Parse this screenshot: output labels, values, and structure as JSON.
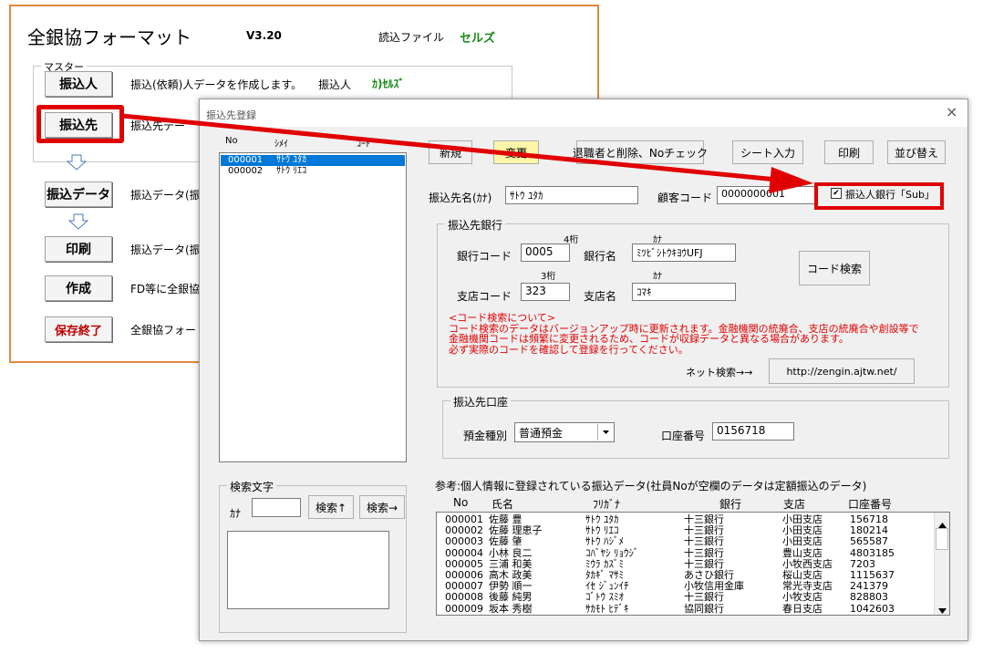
{
  "main": {
    "title": "全銀協フォーマット",
    "version": "V3.20",
    "read_file_label": "読込ファイル",
    "read_file_value": "セルズ",
    "master_group": "マスター",
    "rows": [
      {
        "button": "振込人",
        "desc": "振込(依頼)人データを作成します。",
        "extra_label": "振込人",
        "extra_value": "ｶ)ｾﾙｽﾞ"
      },
      {
        "button": "振込先",
        "desc": "振込先デー"
      },
      {
        "button": "振込データ",
        "desc": "振込データ(振"
      },
      {
        "button": "印刷",
        "desc": "振込データ(振"
      },
      {
        "button": "作成",
        "desc": "FD等に全銀協"
      },
      {
        "button": "保存終了",
        "desc": "全銀協フォー"
      }
    ]
  },
  "dialog": {
    "title": "振込先登録",
    "close": "×",
    "list_headers": {
      "no": "No",
      "shimei": "ｼﾒｲ",
      "code": "ｺｰﾄﾞ"
    },
    "list_items": [
      {
        "no": "000001",
        "name": "ｻﾄｳ ﾕﾀｶ"
      },
      {
        "no": "000002",
        "name": "ｻﾄｳ ﾘｴｺ"
      }
    ],
    "buttons": {
      "new": "新規",
      "change": "変更",
      "retire": "退職者と削除、Noチェック",
      "sheet_input": "シート入力",
      "print": "印刷",
      "sort": "並び替え",
      "code_search": "コード検索",
      "net_url": "http://zengin.ajtw.net/",
      "search_up": "検索↑",
      "search_right": "検索→"
    },
    "payee_name_label": "振込先名(ｶﾅ)",
    "payee_name_value": "ｻﾄｳ ﾕﾀｶ",
    "customer_code_label": "顧客コード",
    "customer_code_value": "0000000001",
    "checkbox_label": "振込人銀行「Sub」",
    "checkbox_mark": "✔",
    "bank_group": "振込先銀行",
    "bank_code_label": "銀行コード",
    "bank_code_hint": "4桁",
    "bank_code_value": "0005",
    "bank_name_label": "銀行名",
    "bank_name_hint": "ｶﾅ",
    "bank_name_value": "ﾐﾂﾋﾞｼﾄｳｷﾖｳUFJ",
    "branch_code_label": "支店コード",
    "branch_code_hint": "3桁",
    "branch_code_value": "323",
    "branch_name_label": "支店名",
    "branch_name_hint": "ｶﾅ",
    "branch_name_value": "ｺﾏｷ",
    "notice_lines": [
      "<コード検索について>",
      "コード検索のデータはバージョンアップ時に更新されます。金融機関の統廃合、支店の統廃合や創設等で",
      "金融機関コードは頻繁に変更されるため、コードが収録データと異なる場合があります。",
      "必ず実際のコードを確認して登録を行ってください。"
    ],
    "net_search_label": "ネット検索→→",
    "account_group": "振込先口座",
    "deposit_type_label": "預金種別",
    "deposit_type_value": "普通預金",
    "account_number_label": "口座番号",
    "account_number_value": "0156718",
    "search_group": "検索文字",
    "kana_label": "ｶﾅ",
    "reference_title": "参考:個人情報に登録されている振込データ(社員Noが空欄のデータは定額振込のデータ)",
    "ref_headers": [
      "No",
      "氏名",
      "ﾌﾘｶﾞﾅ",
      "銀行",
      "支店",
      "口座番号"
    ],
    "ref_rows": [
      [
        "000001",
        "佐藤 豊",
        "ｻﾄｳ ﾕﾀｶ",
        "十三銀行",
        "小田支店",
        "156718"
      ],
      [
        "000002",
        "佐藤 理恵子",
        "ｻﾄｳ ﾘｴｺ",
        "十三銀行",
        "小田支店",
        "180214"
      ],
      [
        "000003",
        "佐藤 肇",
        "ｻﾄｳ ﾊｼﾞﾒ",
        "十三銀行",
        "小田支店",
        "565587"
      ],
      [
        "000004",
        "小林 良二",
        "ｺﾊﾞﾔｼ ﾘｮｳｼﾞ",
        "十三銀行",
        "豊山支店",
        "4803185"
      ],
      [
        "000005",
        "三浦 和美",
        "ﾐｳﾗ ｶｽﾞﾐ",
        "十三銀行",
        "小牧西支店",
        "7203"
      ],
      [
        "000006",
        "高木 政美",
        "ﾀｶｷﾞ ﾏｻﾐ",
        "あさひ銀行",
        "桜山支店",
        "1115637"
      ],
      [
        "000007",
        "伊勢 順一",
        "ｲｾ ｼﾞｭﾝｲﾁ",
        "小牧信用金庫",
        "常光寺支店",
        "241379"
      ],
      [
        "000008",
        "後藤 純男",
        "ｺﾞﾄｳ ｽﾐｵ",
        "十三銀行",
        "小牧支店",
        "828803"
      ],
      [
        "000009",
        "坂本 秀樹",
        "ｻｶﾓﾄ ﾋﾃﾞｷ",
        "協同銀行",
        "春日支店",
        "1042603"
      ]
    ]
  },
  "colors": {
    "highlight_red": "#e00000",
    "main_border": "#e08a3c",
    "selection": "#0078d7",
    "green_text": "#1a8a1a",
    "dark_red_text": "#c00000",
    "change_button_bg": "#fdf5a8"
  }
}
